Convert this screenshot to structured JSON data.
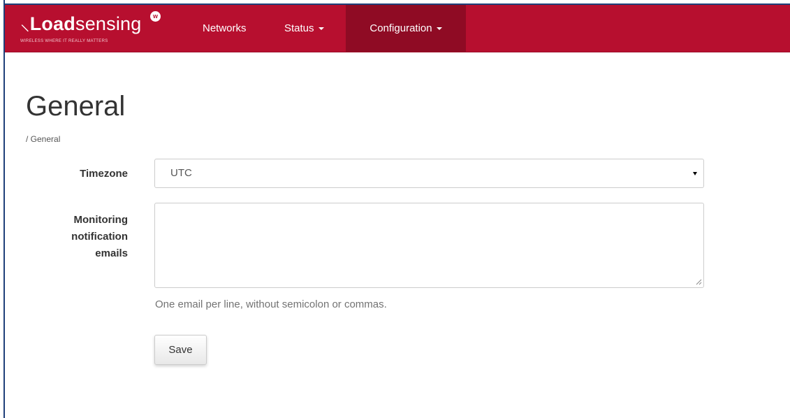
{
  "brand": {
    "name_bold": "Load",
    "name_regular": "sensing",
    "prefix_glyph": "⸜",
    "badge": "w",
    "tagline": "WIRELESS WHERE IT REALLY MATTERS"
  },
  "nav": {
    "items": [
      {
        "label": "Networks",
        "dropdown": false
      },
      {
        "label": "Status",
        "dropdown": true
      },
      {
        "label": "Configuration",
        "dropdown": true,
        "active": true
      }
    ]
  },
  "page": {
    "title": "General",
    "breadcrumb": "/ General"
  },
  "form": {
    "timezone": {
      "label": "Timezone",
      "value": "UTC"
    },
    "emails": {
      "label_line1": "Monitoring",
      "label_line2": "notification",
      "label_line3": "emails",
      "value": "",
      "help": "One email per line, without semicolon or commas."
    },
    "save_label": "Save"
  },
  "colors": {
    "navbar": "#b70f2f",
    "navbar_active": "#8f0b24"
  }
}
